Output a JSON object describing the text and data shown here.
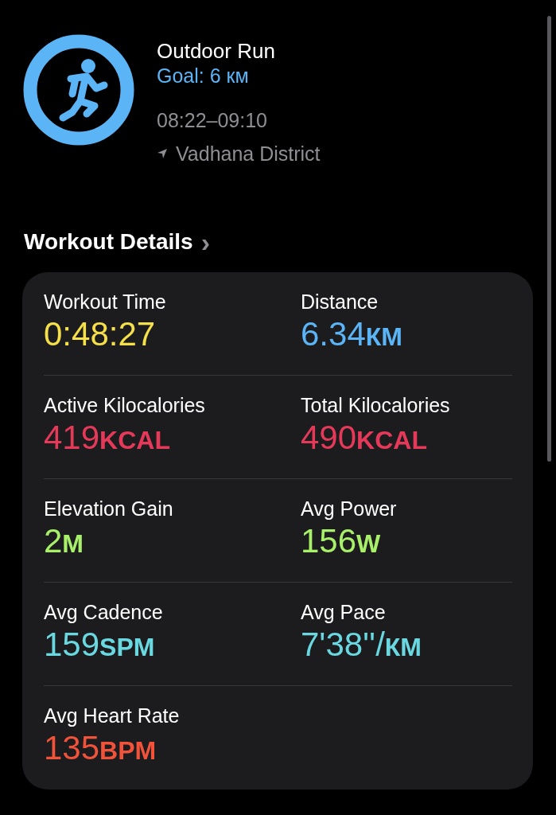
{
  "workout": {
    "title": "Outdoor Run",
    "goal": "Goal: 6 км",
    "time_range": "08:22–09:10",
    "location": "Vadhana District"
  },
  "section": {
    "title": "Workout Details",
    "chevron": "›"
  },
  "metrics": [
    {
      "label": "Workout Time",
      "value": "0:48:27",
      "color": "#f5e04a"
    },
    {
      "label": "Distance",
      "value": "6.34",
      "unit": "КМ",
      "color": "#5ab4f5"
    },
    {
      "label": "Active Kilocalories",
      "value": "419",
      "unit": "KCAL",
      "color": "#e5395a"
    },
    {
      "label": "Total Kilocalories",
      "value": "490",
      "unit": "KCAL",
      "color": "#e5395a"
    },
    {
      "label": "Elevation Gain",
      "value": "2",
      "unit": "М",
      "color": "#a8f06a"
    },
    {
      "label": "Avg Power",
      "value": "156",
      "unit": "W",
      "color": "#a8f06a"
    },
    {
      "label": "Avg Cadence",
      "value": "159",
      "unit": "SPM",
      "color": "#6ad8e0"
    },
    {
      "label": "Avg Pace",
      "value": "7'38''/",
      "unit": "КМ",
      "color": "#6ad8e0"
    },
    {
      "label": "Avg Heart Rate",
      "value": "135",
      "unit": "BPM",
      "color": "#f0523a"
    }
  ]
}
